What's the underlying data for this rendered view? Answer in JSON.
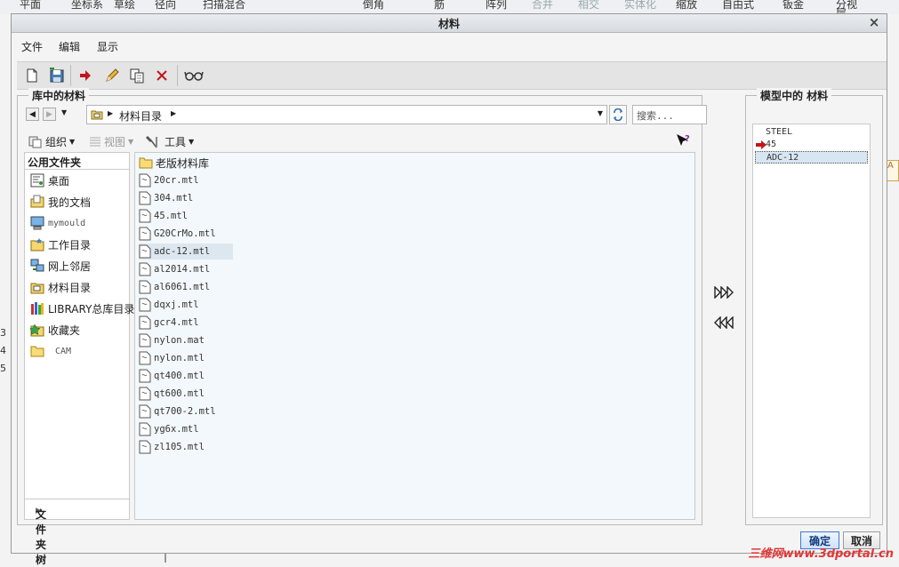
{
  "background": {
    "toolbar_items": [
      "平面",
      "坐标系",
      "草绘",
      "径向",
      "扫描混合",
      "倒角",
      "筋",
      "阵列",
      "合并",
      "相交",
      "实体化",
      "缩放",
      "自由式",
      "钣金",
      "分视",
      "层"
    ],
    "left_numbers": [
      "3",
      "4",
      "5"
    ],
    "right_tab": "A"
  },
  "dialog": {
    "title": "材料",
    "close": "×",
    "menu": [
      "文件",
      "编辑",
      "显示"
    ],
    "library_group_title": "库中的材料",
    "model_group_title": "模型中的 材料",
    "address": {
      "path": "材料目录",
      "search_placeholder": "搜索..."
    },
    "commands": {
      "organize": "组织",
      "view": "视图",
      "tools": "工具"
    },
    "favorites": {
      "header": "公用文件夹",
      "items": [
        {
          "label": "桌面",
          "icon": "desktop-icon"
        },
        {
          "label": "我的文档",
          "icon": "documents-icon"
        },
        {
          "label": "mymould",
          "icon": "computer-icon"
        },
        {
          "label": "工作目录",
          "icon": "working-dir-icon"
        },
        {
          "label": "网上邻居",
          "icon": "network-icon"
        },
        {
          "label": "材料目录",
          "icon": "material-dir-icon"
        },
        {
          "label": "LIBRARY总库目录",
          "icon": "library-icon"
        },
        {
          "label": "收藏夹",
          "icon": "favorites-icon"
        },
        {
          "label": "CAM",
          "icon": "folder-icon"
        }
      ],
      "folder_tree": "文件夹树"
    },
    "files": [
      {
        "name": "老版材料库",
        "type": "folder"
      },
      {
        "name": "20cr.mtl",
        "type": "file"
      },
      {
        "name": "304.mtl",
        "type": "file"
      },
      {
        "name": "45.mtl",
        "type": "file"
      },
      {
        "name": "G20CrMo.mtl",
        "type": "file"
      },
      {
        "name": "adc-12.mtl",
        "type": "file"
      },
      {
        "name": "al2014.mtl",
        "type": "file"
      },
      {
        "name": "al6061.mtl",
        "type": "file"
      },
      {
        "name": "dqxj.mtl",
        "type": "file"
      },
      {
        "name": "gcr4.mtl",
        "type": "file"
      },
      {
        "name": "nylon.mat",
        "type": "file"
      },
      {
        "name": "nylon.mtl",
        "type": "file"
      },
      {
        "name": "qt400.mtl",
        "type": "file"
      },
      {
        "name": "qt600.mtl",
        "type": "file"
      },
      {
        "name": "qt700-2.mtl",
        "type": "file"
      },
      {
        "name": "yg6x.mtl",
        "type": "file"
      },
      {
        "name": "zl105.mtl",
        "type": "file"
      }
    ],
    "selected_file": "adc-12.mtl",
    "model_materials": [
      "STEEL",
      "45",
      "ADC-12"
    ],
    "current_material": "45",
    "selected_model_material": "ADC-12",
    "buttons": {
      "ok": "确定",
      "cancel": "取消"
    }
  },
  "watermark": "三维网www.3dportal.cn",
  "colors": {
    "accent": "#3d7bd0",
    "watermark": "#e23636",
    "current_arrow": "#c0171d"
  }
}
